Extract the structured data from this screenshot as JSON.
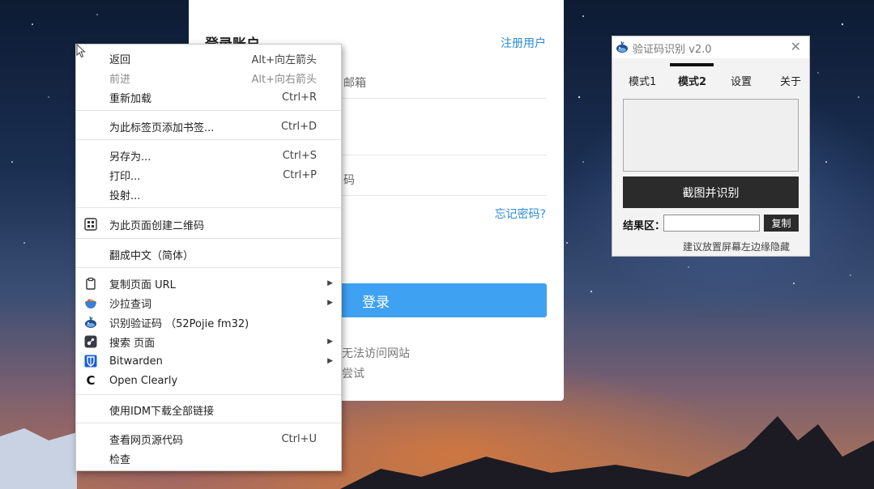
{
  "login": {
    "title": "登录账户",
    "register_link": "注册用户",
    "username_hint": "邮箱",
    "password_hint": "码",
    "forgot_link": "忘记密码?",
    "login_button": "登录",
    "tip_line1": "无法访问网站",
    "tip_line2": "尝试"
  },
  "context_menu": {
    "items": [
      {
        "label": "返回",
        "shortcut": "Alt+向左箭头"
      },
      {
        "label": "前进",
        "shortcut": "Alt+向右箭头"
      },
      {
        "label": "重新加载",
        "shortcut": "Ctrl+R"
      },
      {
        "label": "为此标签页添加书签...",
        "shortcut": "Ctrl+D"
      },
      {
        "label": "另存为...",
        "shortcut": "Ctrl+S"
      },
      {
        "label": "打印...",
        "shortcut": "Ctrl+P"
      },
      {
        "label": "投射..."
      },
      {
        "label": "为此页面创建二维码",
        "icon": "qr-code-icon"
      },
      {
        "label": "翻成中文（简体）"
      },
      {
        "label": "复制页面 URL",
        "icon": "clipboard-icon"
      },
      {
        "label": "沙拉查词",
        "icon": "saladict-icon"
      },
      {
        "label": "识别验证码 （52Pojie fm32)",
        "icon": "captcha-whale-icon"
      },
      {
        "label": "搜索 页面",
        "icon": "search-extension-icon"
      },
      {
        "label": "Bitwarden",
        "icon": "bitwarden-icon"
      },
      {
        "label": "Open Clearly",
        "icon": "clearly-icon"
      },
      {
        "label": "使用IDM下载全部链接"
      },
      {
        "label": "查看网页源代码",
        "shortcut": "Ctrl+U"
      },
      {
        "label": "检查"
      }
    ]
  },
  "captcha_tool": {
    "title": "验证码识别 v2.0",
    "tabs": [
      "模式1",
      "模式2",
      "设置",
      "关于"
    ],
    "active_tab": "模式2",
    "capture_button": "截图并识别",
    "result_label": "结果区：",
    "result_value": "",
    "copy_button": "复制",
    "hint": "建议放置屏幕左边缘隐藏"
  },
  "colors": {
    "accent_blue": "#3ea1f2",
    "link_blue": "#2a8bd8",
    "dark_button": "#2b2b2b"
  }
}
